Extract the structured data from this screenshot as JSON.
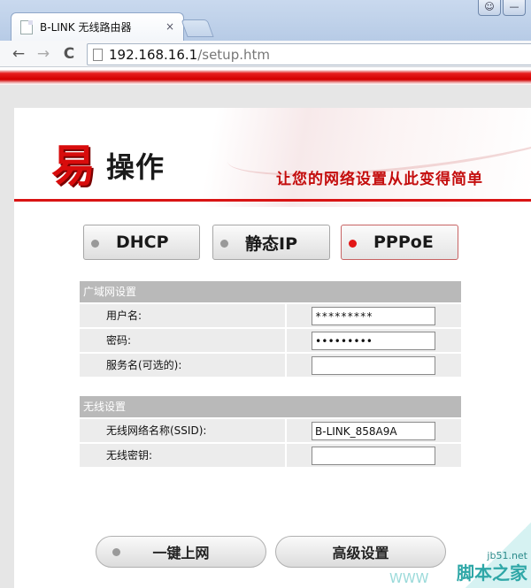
{
  "browser": {
    "tab_title": "B-LINK 无线路由器",
    "tab_close": "×",
    "url_host": "192.168.16.1",
    "url_path": "/setup.htm",
    "back": "←",
    "forward": "→",
    "reload": "C"
  },
  "banner": {
    "logo_char": "易",
    "logo_text": "操作",
    "slogan": "让您的网络设置从此变得简单"
  },
  "modes": {
    "dhcp": "DHCP",
    "static_ip": "静态IP",
    "pppoe": "PPPoE",
    "active": "PPPoE"
  },
  "wan": {
    "title": "广域网设置",
    "username_label": "用户名:",
    "username_value": "*********",
    "password_label": "密码:",
    "password_value": "•••••••••",
    "service_label": "服务名(可选的):",
    "service_value": ""
  },
  "wireless": {
    "title": "无线设置",
    "ssid_label": "无线网络名称(SSID):",
    "ssid_value": "B-LINK_858A9A",
    "key_label": "无线密钥:",
    "key_value": ""
  },
  "actions": {
    "connect": "一键上网",
    "advanced": "高级设置"
  },
  "watermark": {
    "site": "jb51.net",
    "name": "脚本之家",
    "www": "WWW"
  },
  "colors": {
    "accent_red": "#d80c0c",
    "section_header": "#b9b9b9",
    "active_dot": "#e21616"
  }
}
